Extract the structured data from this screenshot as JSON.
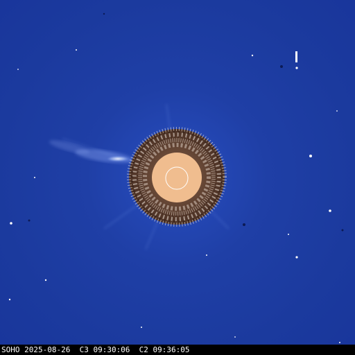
{
  "image": {
    "timestamp_text": "SOHO 2025-08-26  C3 09:30:06  C2 09:36:05"
  },
  "colors": {
    "background_blue": "#1f3fa6",
    "occulter_disk": "#f0bd8f",
    "sun_outline": "#ffffff",
    "inner_ring_dark": "#3a2418",
    "inner_ring_light": "#f3e7dc",
    "star": "#ffffff",
    "stamp_bar": "#000000"
  }
}
